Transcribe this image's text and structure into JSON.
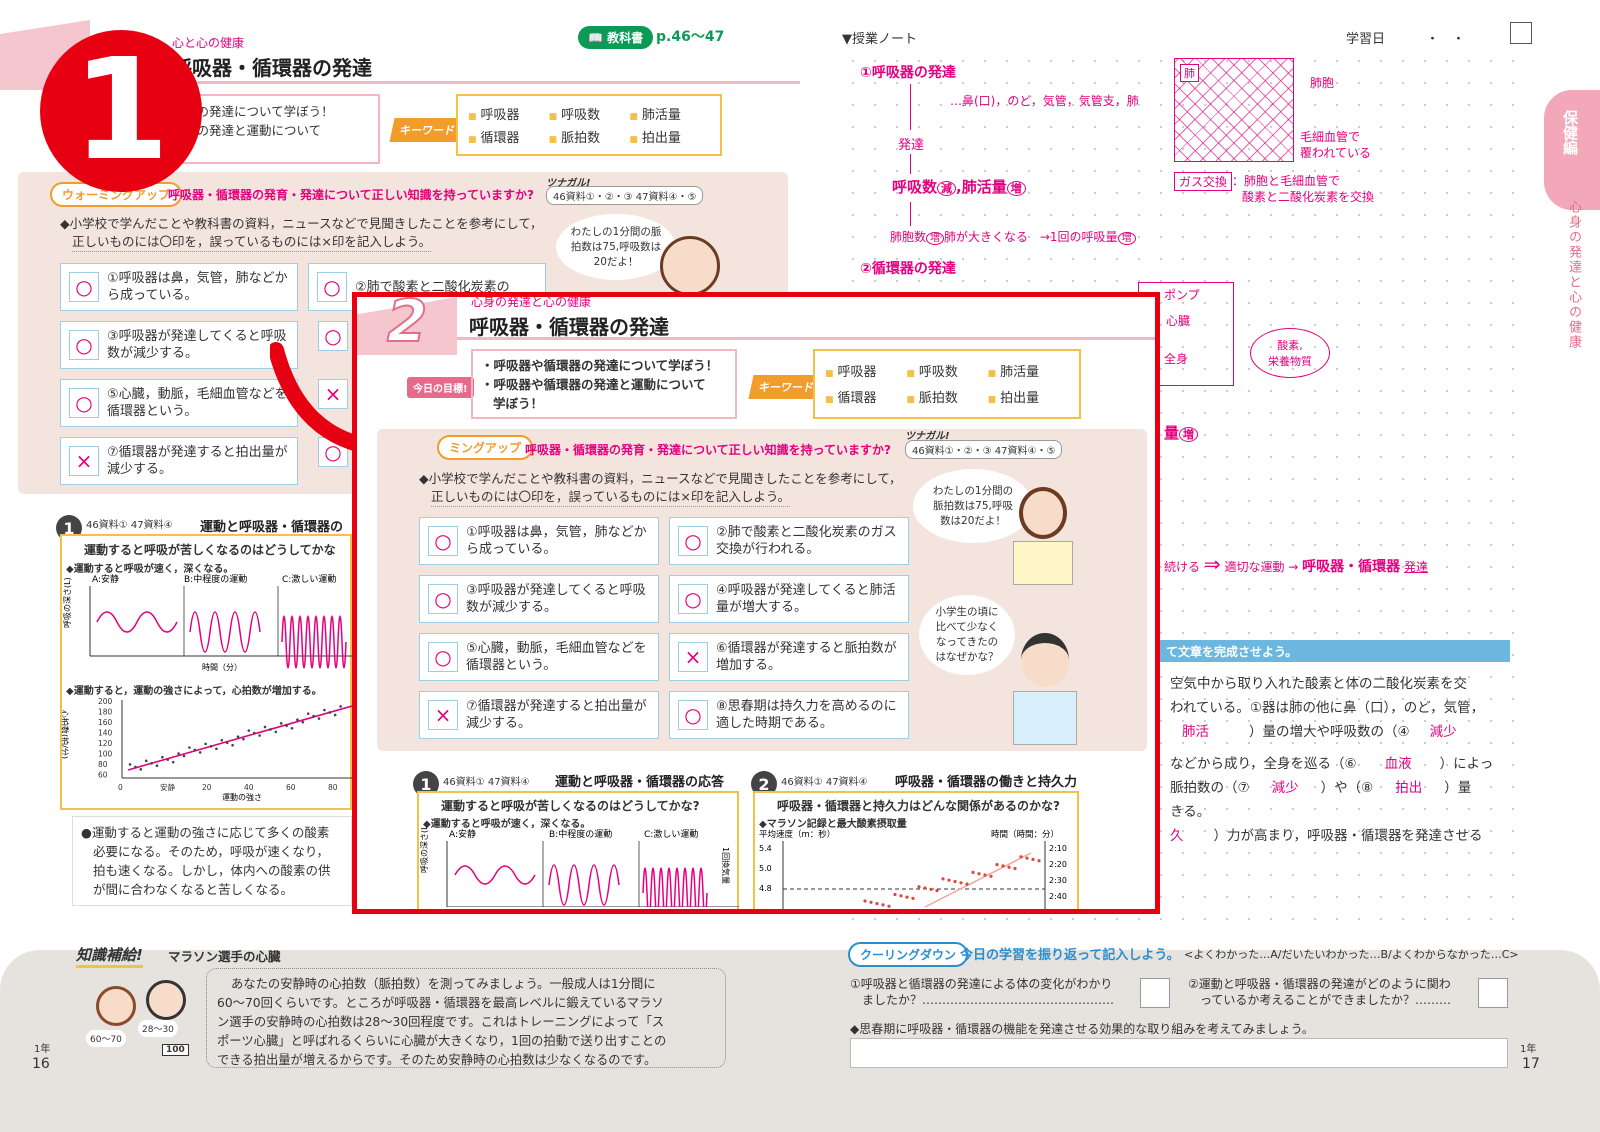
{
  "left_page": {
    "unit": "心と心の健康",
    "lesson_num": "2",
    "title": "呼吸器・循環器の発達",
    "textbook_label": "教科書",
    "textbook_pages": "p.46〜47",
    "goal_line1": "器の発達について学ぼう！",
    "goal_line2": "器の発達と運動について",
    "keyword_label": "キーワード!",
    "keywords": [
      "呼吸器",
      "呼吸数",
      "肺活量",
      "循環器",
      "脈拍数",
      "拍出量"
    ],
    "warmup_label": "ウォーミングアップ",
    "warmup_q": "呼吸器・循環器の発育・発達について正しい知識を持っていますか?",
    "tsunagaru": "ツナガル!",
    "tsunagaru_refs": "46資料①・②・③ 47資料④・⑤",
    "instruction1": "◆小学校で学んだことや教科書の資料，ニュースなどで見聞きしたことを参考にして，",
    "instruction2": "正しいものには〇印を，誤っているものには×印を記入しよう。",
    "bubble": "わたしの1分間の脈拍数は75,呼吸数は20だよ！",
    "questions": [
      {
        "mark": "○",
        "text": "①呼吸器は鼻，気管，肺などから成っている。"
      },
      {
        "mark": "○",
        "text": "②肺で酸素と二酸化炭素の"
      },
      {
        "mark": "○",
        "text": "③呼吸器が発達してくると呼吸数が減少する。"
      },
      {
        "mark": "○",
        "text": "⑤心臓，動脈，毛細血管などを循環器という。"
      },
      {
        "mark": "×",
        "text": "⑦循環器が発達すると拍出量が減少する。"
      }
    ],
    "sec1_refs": "46資料① 47資料④",
    "sec1_title": "運動と呼吸器・循環器の",
    "sec1_q": "運動すると呼吸が苦しくなるのはどうしてかな",
    "sec1_sub": "◆運動すると呼吸が速く，深くなる。",
    "sec1_sub2": "◆運動すると，運動の強さによって，心拍数が増加する。",
    "sec1_graph_labels": [
      "A:安静",
      "B:中程度の運動",
      "C:激しい運動"
    ],
    "sec1_ylabel": "呼吸の深さ(L)",
    "sec1_xlabel": "時間（分）",
    "sec1_ylabel2": "心拍数(拍/分)",
    "sec1_xlabel2": "運動の強さ",
    "sec1_x2_ticks": [
      "0",
      "安静",
      "20",
      "40",
      "60",
      "80"
    ],
    "sec1_y2_ticks": [
      "200",
      "180",
      "160",
      "140",
      "120",
      "100",
      "80",
      "60"
    ],
    "summary1": "●運動すると運動の強さに応じて多くの酸素",
    "summary2": "必要になる。そのため，呼吸が速くなり，",
    "summary3": "拍も速くなる。しかし，体内への酸素の供",
    "summary4": "が間に合わなくなると苦しくなる。",
    "tip_label": "知識補給!",
    "tip_title": "マラソン選手の心臓",
    "tip_text1": "あなたの安静時の心拍数（脈拍数）を測ってみましょう。一般成人は1分間に",
    "tip_text2": "60〜70回くらいです。ところが呼吸器・循環器を最高レベルに鍛えているマラソ",
    "tip_text3": "ン選手の安静時の心拍数は28〜30回程度です。これはトレーニングによって「ス",
    "tip_text4": "ポーツ心臓」と呼ばれるくらいに心臓が大きくなり，1回の拍動で送り出すことの",
    "tip_text5": "できる拍出量が増えるからです。そのため安静時の心拍数は少なくなるのです。",
    "tip_bubble1": "60〜70",
    "tip_bubble2": "28〜30",
    "tip_bib": "100",
    "grade": "1年",
    "page_no": "16"
  },
  "right_page": {
    "notes_label": "▼授業ノート",
    "study_date": "学習日",
    "date_dots": "・　・",
    "side_tab": "保健編",
    "side_vertical": "心身の発達と心の健康",
    "note1": "①呼吸器の発達",
    "note1_detail": "…鼻(口)，のど，気管，気管支，肺",
    "note_hattatsu": "発達",
    "note_kokyu": "呼吸数",
    "note_gen": "減",
    "note_haikatsu": "肺活量",
    "note_zou": "増",
    "note_haiho": "肺胞数",
    "note_haiho2": "肺が大きくなる",
    "note_arrow": "→1回の呼吸量",
    "note_lung": "肺",
    "note_alveoli": "肺胞",
    "note_capillary1": "毛細血管で",
    "note_capillary2": "覆われている",
    "note_gas": "ガス交換",
    "note_gas1": "：肺胞と毛細血管で",
    "note_gas2": "酸素と二酸化炭素を交換",
    "note2": "②循環器の発達",
    "note_pump": "ポンプ",
    "note_heart": "心臓",
    "note_body": "全身",
    "note_oxygen1": "酸素,",
    "note_oxygen2": "栄養物質",
    "note_ryo": "量",
    "note_flow1": "続ける",
    "note_flow2": "適切な運動",
    "note_flow3": "呼吸器・循環器",
    "note_flow4": "発達",
    "complete_label": "て文章を完成させよう。",
    "para1": "空気中から取り入れた酸素と体の二酸化炭素を交",
    "para2": "われている。①器は肺の他に鼻（口），のど，気管，",
    "para3a": "肺活",
    "para3b": "）量の増大や呼吸数の（④",
    "para3c": "減少",
    "para4a": "などから成り，全身を巡る（⑥",
    "para4b": "血液",
    "para4c": "）によっ",
    "para5a": "脈拍数の（⑦",
    "para5b": "減少",
    "para5c": "）や（⑧",
    "para5d": "拍出",
    "para5e": "）量",
    "para6": "きる。",
    "para7a": "久",
    "para7b": "）力が高まり，呼吸器・循環器を発達させる",
    "cool_label": "クーリングダウン",
    "cool_title": "今日の学習を振り返って記入しよう。",
    "cool_scale": "<よくわかった…A/だいたいわかった…B/よくわからなかった…C>",
    "cool_q1a": "①呼吸器と循環器の発達による体の変化がわかり",
    "cool_q1b": "ましたか？…………………………………………",
    "cool_q2a": "②運動と呼吸器・循環器の発達がどのように関わ",
    "cool_q2b": "っているか考えることができましたか？………",
    "cool_q3": "◆思春期に呼吸器・循環器の機能を発達させる効果的な取り組みを考えてみましょう。",
    "grade": "1年",
    "page_no": "17"
  },
  "callout_number": "1",
  "zoom": {
    "unit": "心身の発達と心の健康",
    "lesson_num": "2",
    "title": "呼吸器・循環器の発達",
    "goal_label": "今日の目標!",
    "goal1": "・呼吸器や循環器の発達について学ぼう！",
    "goal2": "・呼吸器や循環器の発達と運動について",
    "goal3": "学ぼう！",
    "keyword_label": "キーワード!",
    "keywords": [
      "呼吸器",
      "呼吸数",
      "肺活量",
      "循環器",
      "脈拍数",
      "拍出量"
    ],
    "warmup_label": "ミングアップ",
    "warmup_q": "呼吸器・循環器の発育・発達について正しい知識を持っていますか?",
    "tsunagaru": "ツナガル!",
    "tsunagaru_refs": "46資料①・②・③ 47資料④・⑤",
    "instruction1": "◆小学校で学んだことや教科書の資料，ニュースなどで見聞きしたことを参考にして，",
    "instruction2": "正しいものには〇印を，誤っているものには×印を記入しよう。",
    "bubble1": "わたしの1分間の脈拍数は75,呼吸数は20だよ！",
    "bubble2": "小学生の頃に比べて少なくなってきたのはなぜかな？",
    "questions": [
      {
        "mark": "○",
        "text": "①呼吸器は鼻，気管，肺などから成っている。"
      },
      {
        "mark": "○",
        "text": "②肺で酸素と二酸化炭素のガス交換が行われる。"
      },
      {
        "mark": "○",
        "text": "③呼吸器が発達してくると呼吸数が減少する。"
      },
      {
        "mark": "○",
        "text": "④呼吸器が発達してくると肺活量が増大する。"
      },
      {
        "mark": "○",
        "text": "⑤心臓，動脈，毛細血管などを循環器という。"
      },
      {
        "mark": "×",
        "text": "⑥循環器が発達すると脈拍数が増加する。"
      },
      {
        "mark": "×",
        "text": "⑦循環器が発達すると拍出量が減少する。"
      },
      {
        "mark": "○",
        "text": "⑧思春期は持久力を高めるのに適した時期である。"
      }
    ],
    "sec1_refs": "46資料① 47資料④",
    "sec1_title": "運動と呼吸器・循環器の応答",
    "sec1_q": "運動すると呼吸が苦しくなるのはどうしてかな?",
    "sec1_sub": "◆運動すると呼吸が速く，深くなる。",
    "sec1_graph_labels": [
      "A:安静",
      "B:中程度の運動",
      "C:激しい運動"
    ],
    "sec1_ylabel": "呼吸の深さ(L)",
    "sec1_side": "1回換気量",
    "sec2_refs": "46資料① 47資料④",
    "sec2_title": "呼吸器・循環器の働きと持久力",
    "sec2_q": "呼吸器・循環器と持久力はどんな関係があるのかな?",
    "sec2_sub": "◆マラソン記録と最大酸素摂取量",
    "sec2_ylabel": "平均速度（m：秒）",
    "sec2_yticks": [
      "5.4",
      "5.0",
      "4.8"
    ],
    "sec2_rlabel": "時間（時間：分）",
    "sec2_rticks": [
      "2:10",
      "2:20",
      "2:30",
      "2:40"
    ]
  }
}
